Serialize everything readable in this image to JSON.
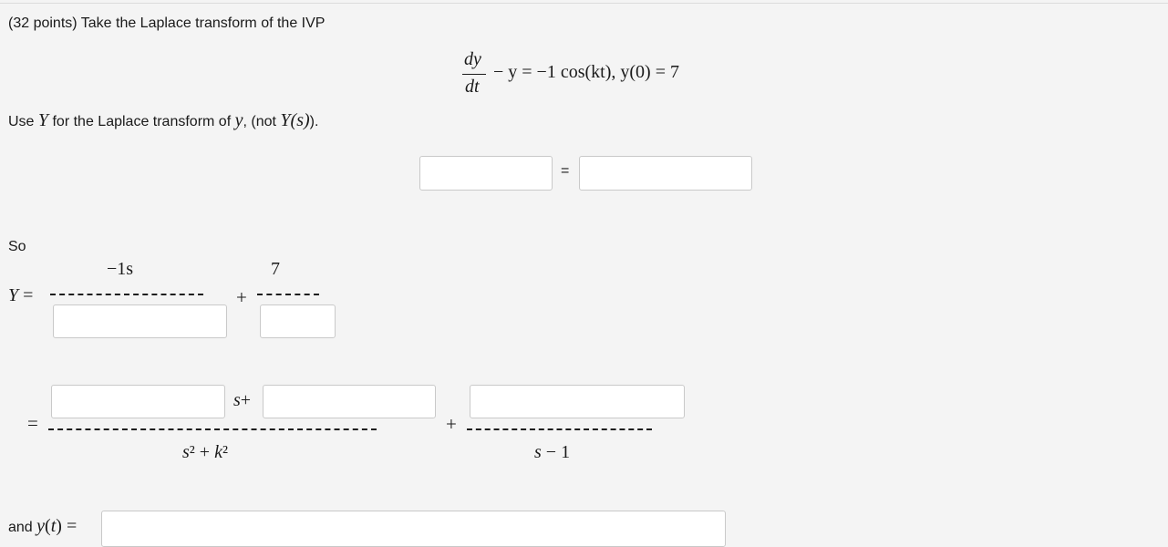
{
  "problem": {
    "header": "(32 points) Take the Laplace transform of the IVP",
    "ivp": {
      "dy": "dy",
      "dt": "dt",
      "rest": "− y = −1 cos(kt), y(0) = 7"
    },
    "instruction_use": "Use",
    "instruction_Y": "Y",
    "instruction_mid": "for the Laplace transform of",
    "instruction_y": "y",
    "instruction_not": ", (not",
    "instruction_Ys": "Y(s)",
    "instruction_end": ")."
  },
  "transform_row": {
    "equals": "="
  },
  "so_section": {
    "so_label": "So",
    "Y_label": "Y =",
    "term1_numerator": "−1s",
    "plus1": "+",
    "term2_numerator": "7"
  },
  "combined_section": {
    "equals": "=",
    "s_plus": "s+",
    "plus": "+",
    "denominator1": "s² + k²",
    "denominator2": "s − 1"
  },
  "final": {
    "and_label": "and",
    "yt_label": "y(t) ="
  }
}
